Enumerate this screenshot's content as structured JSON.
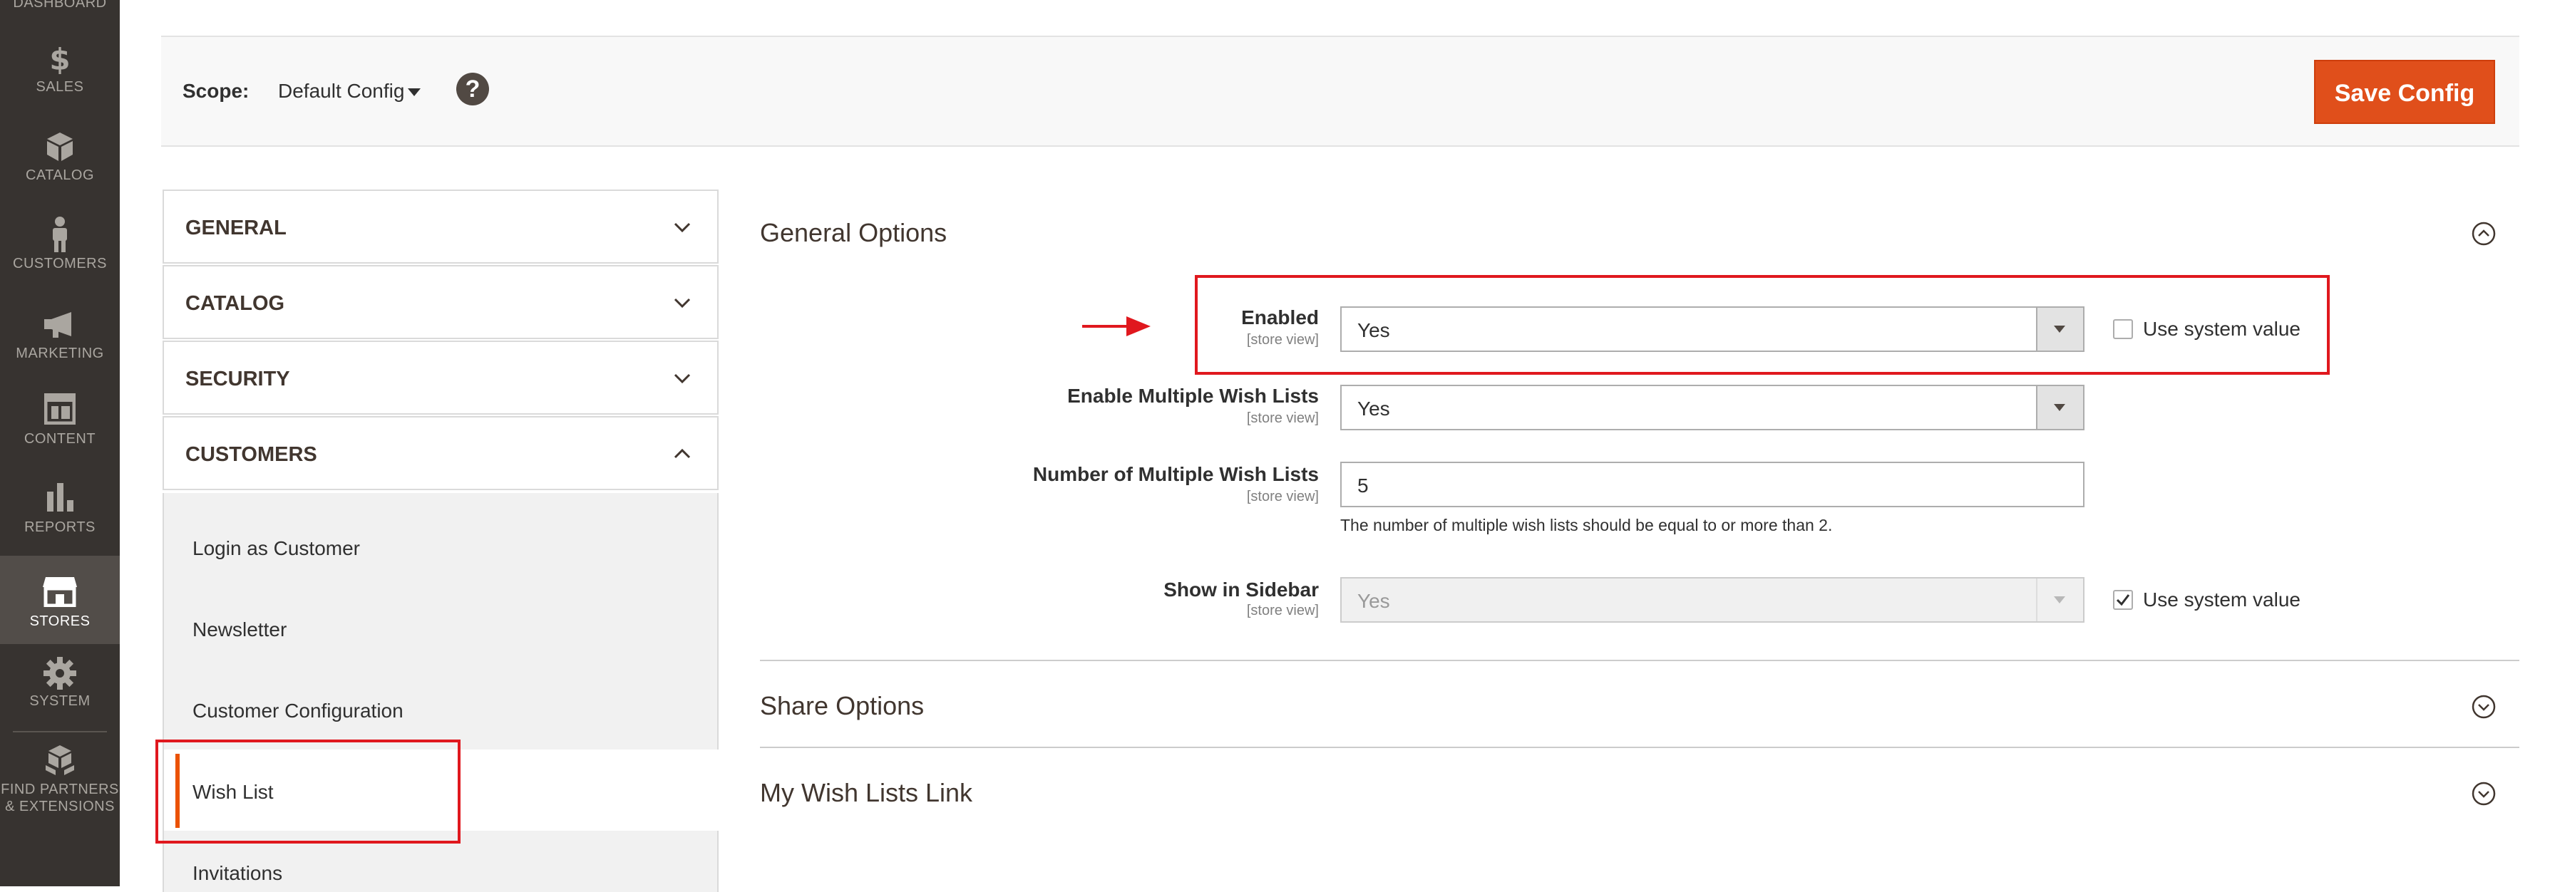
{
  "nav": {
    "items": [
      {
        "label": "DASHBOARD",
        "icon": "dashboard-icon"
      },
      {
        "label": "SALES",
        "icon": "dollar-icon"
      },
      {
        "label": "CATALOG",
        "icon": "box-icon"
      },
      {
        "label": "CUSTOMERS",
        "icon": "person-icon"
      },
      {
        "label": "MARKETING",
        "icon": "megaphone-icon"
      },
      {
        "label": "CONTENT",
        "icon": "layout-icon"
      },
      {
        "label": "REPORTS",
        "icon": "bar-chart-icon"
      },
      {
        "label": "STORES",
        "icon": "storefront-icon"
      },
      {
        "label": "SYSTEM",
        "icon": "gear-icon"
      }
    ],
    "partners": {
      "line1": "FIND PARTNERS",
      "line2": "& EXTENSIONS",
      "icon": "cubes-icon"
    },
    "active": "STORES",
    "active_bg": "#524d49"
  },
  "header": {
    "scope_label": "Scope:",
    "scope_value": "Default Config",
    "help_icon": "?",
    "save_label": "Save Config",
    "save_color": "#e04f1b"
  },
  "tabs": {
    "items": [
      {
        "label": "GENERAL",
        "expanded": false
      },
      {
        "label": "CATALOG",
        "expanded": false
      },
      {
        "label": "SECURITY",
        "expanded": false
      },
      {
        "label": "CUSTOMERS",
        "expanded": true
      }
    ],
    "customers_sub": [
      "Login as Customer",
      "Newsletter",
      "Customer Configuration",
      "Wish List",
      "Invitations"
    ],
    "active_sub": "Wish List",
    "accent": "#eb5202"
  },
  "content": {
    "general": {
      "title": "General Options",
      "fields": {
        "enabled": {
          "label": "Enabled",
          "scope": "[store view]",
          "value": "Yes",
          "use_system": "Use system value",
          "checked": false
        },
        "multiple": {
          "label": "Enable Multiple Wish Lists",
          "scope": "[store view]",
          "value": "Yes"
        },
        "number": {
          "label": "Number of Multiple Wish Lists",
          "scope": "[store view]",
          "value": "5",
          "note": "The number of multiple wish lists should be equal to or more than 2."
        },
        "sidebar": {
          "label": "Show in Sidebar",
          "scope": "[store view]",
          "value": "Yes",
          "use_system": "Use system value",
          "checked": true
        }
      }
    },
    "share": {
      "title": "Share Options"
    },
    "mylinks": {
      "title": "My Wish Lists Link"
    }
  },
  "annotation": {
    "color": "#e0181e"
  }
}
